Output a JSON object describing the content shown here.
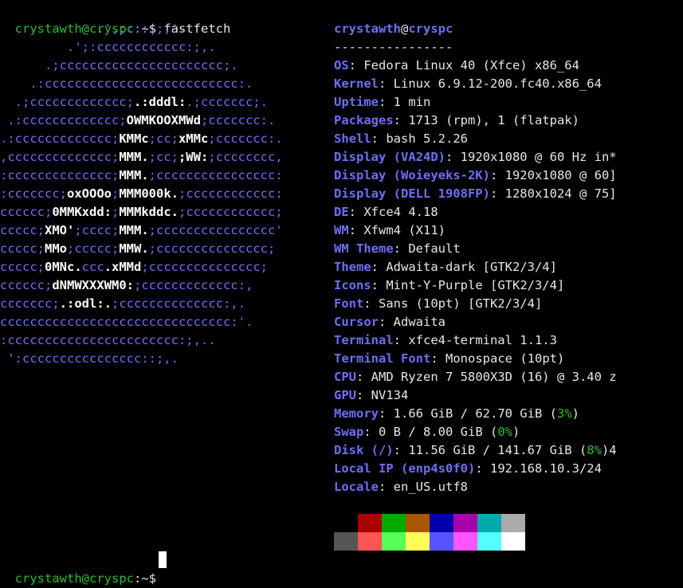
{
  "terminal": {
    "top_prompt": {
      "user_host": "crystawth@cryspc",
      "path": ":~$ ",
      "command": "fastfetch"
    },
    "bottom_prompt": {
      "user_host": "crystawth@cryspc",
      "path": ":~$ "
    }
  },
  "ascii_logo": [
    [
      {
        "t": "             .',;::::;,'.",
        "b": false
      }
    ],
    [
      {
        "t": "         .';:cccccccccccc:;,.",
        "b": false
      }
    ],
    [
      {
        "t": "      .;cccccccccccccccccccccc;.",
        "b": false
      }
    ],
    [
      {
        "t": "    .:cccccccccccccccccccccccccc:.",
        "b": false
      }
    ],
    [
      {
        "t": "  .;ccccccccccccc;",
        "b": false
      },
      {
        "t": ".:dddl:",
        "b": true
      },
      {
        "t": ".;ccccccc;.",
        "b": false
      }
    ],
    [
      {
        "t": " .:ccccccccccccc;",
        "b": false
      },
      {
        "t": "OWMKOOXMWd",
        "b": true
      },
      {
        "t": ";ccccccc:.",
        "b": false
      }
    ],
    [
      {
        "t": ".:ccccccccccccc;",
        "b": false
      },
      {
        "t": "KMMc",
        "b": true
      },
      {
        "t": ";cc;",
        "b": false
      },
      {
        "t": "xMMc",
        "b": true
      },
      {
        "t": ";ccccccc:.",
        "b": false
      }
    ],
    [
      {
        "t": ",cccccccccccccc;",
        "b": false
      },
      {
        "t": "MMM.",
        "b": true
      },
      {
        "t": ";cc;",
        "b": false
      },
      {
        "t": ";WW:",
        "b": true
      },
      {
        "t": ";cccccccc,",
        "b": false
      }
    ],
    [
      {
        "t": ":cccccccccccccc;",
        "b": false
      },
      {
        "t": "MMM.",
        "b": true
      },
      {
        "t": ";cccccccccccccccc:",
        "b": false
      }
    ],
    [
      {
        "t": ":ccccccc;",
        "b": false
      },
      {
        "t": "oxOOOo",
        "b": true
      },
      {
        "t": ";",
        "b": false
      },
      {
        "t": "MMM000k.",
        "b": true
      },
      {
        "t": ";cccccccccccc:",
        "b": false
      }
    ],
    [
      {
        "t": "cccccc;",
        "b": false
      },
      {
        "t": "0MMKxdd:",
        "b": true
      },
      {
        "t": ";",
        "b": false
      },
      {
        "t": "MMMkddc.",
        "b": true
      },
      {
        "t": ";cccccccccccc;",
        "b": false
      }
    ],
    [
      {
        "t": "ccccc;",
        "b": false
      },
      {
        "t": "XMO'",
        "b": true
      },
      {
        "t": ";cccc;",
        "b": false
      },
      {
        "t": "MMM.",
        "b": true
      },
      {
        "t": ";cccccccccccccccc'",
        "b": false
      }
    ],
    [
      {
        "t": "ccccc;",
        "b": false
      },
      {
        "t": "MMo",
        "b": true
      },
      {
        "t": ";ccccc;",
        "b": false
      },
      {
        "t": "MMW.",
        "b": true
      },
      {
        "t": ";ccccccccccccccc;",
        "b": false
      }
    ],
    [
      {
        "t": "ccccc;",
        "b": false
      },
      {
        "t": "0MNc.",
        "b": true
      },
      {
        "t": "ccc",
        "b": false
      },
      {
        "t": ".xMMd",
        "b": true
      },
      {
        "t": ";ccccccccccccccc;",
        "b": false
      }
    ],
    [
      {
        "t": "cccccc;",
        "b": false
      },
      {
        "t": "dNMWXXXWM0:",
        "b": true
      },
      {
        "t": ";ccccccccccccc:,",
        "b": false
      }
    ],
    [
      {
        "t": "ccccccc;",
        "b": false
      },
      {
        "t": ".:odl:.",
        "b": true
      },
      {
        "t": ";cccccccccccccc:,.",
        "b": false
      }
    ],
    [
      {
        "t": "ccccccccccccccccccccccccccccccc:'.",
        "b": false
      }
    ],
    [
      {
        "t": ":ccccccccccccccccccccccc:;,..",
        "b": false
      }
    ],
    [
      {
        "t": " ':cccccccccccccccc::;,.",
        "b": false
      }
    ]
  ],
  "info": {
    "user": "crystawth",
    "at": "@",
    "host": "cryspc",
    "separator": "----------------",
    "rows": [
      {
        "key": "OS",
        "val": "Fedora Linux 40 (Xfce) x86_64"
      },
      {
        "key": "Kernel",
        "val": "Linux 6.9.12-200.fc40.x86_64"
      },
      {
        "key": "Uptime",
        "val": "1 min"
      },
      {
        "key": "Packages",
        "val": "1713 (rpm), 1 (flatpak)"
      },
      {
        "key": "Shell",
        "val": "bash 5.2.26"
      },
      {
        "key": "Display (VA24D)",
        "val": "1920x1080 @ 60 Hz in*"
      },
      {
        "key": "Display (Woieyeks-2K)",
        "val": "1920x1080 @ 60]"
      },
      {
        "key": "Display (DELL 1908FP)",
        "val": "1280x1024 @ 75]"
      },
      {
        "key": "DE",
        "val": "Xfce4 4.18"
      },
      {
        "key": "WM",
        "val": "Xfwm4 (X11)"
      },
      {
        "key": "WM Theme",
        "val": "Default"
      },
      {
        "key": "Theme",
        "val": "Adwaita-dark [GTK2/3/4]"
      },
      {
        "key": "Icons",
        "val": "Mint-Y-Purple [GTK2/3/4]"
      },
      {
        "key": "Font",
        "val": "Sans (10pt) [GTK2/3/4]"
      },
      {
        "key": "Cursor",
        "val": "Adwaita"
      },
      {
        "key": "Terminal",
        "val": "xfce4-terminal 1.1.3"
      },
      {
        "key": "Terminal Font",
        "val": "Monospace (10pt)"
      },
      {
        "key": "CPU",
        "val": "AMD Ryzen 7 5800X3D (16) @ 3.40 z"
      },
      {
        "key": "GPU",
        "val": "NV134"
      },
      {
        "key": "Memory",
        "val": "1.66 GiB / 62.70 GiB (",
        "pct": "3%",
        "tail": ")"
      },
      {
        "key": "Swap",
        "val": "0 B / 8.00 GiB (",
        "pct": "0%",
        "tail": ")"
      },
      {
        "key": "Disk (/)",
        "val": "11.56 GiB / 141.67 GiB (",
        "pct": "8%",
        "tail": ")4"
      },
      {
        "key": "Local IP (enp4s0f0)",
        "val": "192.168.10.3/24"
      },
      {
        "key": "Locale",
        "val": "en_US.utf8"
      }
    ]
  },
  "palette": {
    "normal": [
      "#000000",
      "#aa0000",
      "#00aa00",
      "#aa5500",
      "#0000aa",
      "#aa00aa",
      "#00aaaa",
      "#aaaaaa"
    ],
    "bright": [
      "#555555",
      "#ff5555",
      "#55ff55",
      "#ffff55",
      "#5555ff",
      "#ff55ff",
      "#55ffff",
      "#ffffff"
    ]
  }
}
